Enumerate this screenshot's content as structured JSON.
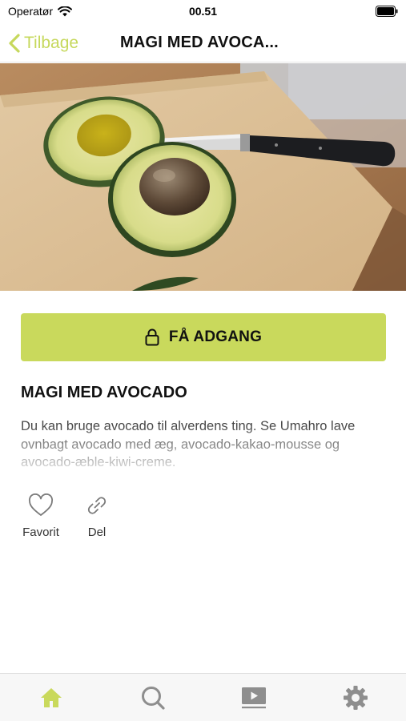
{
  "status_bar": {
    "carrier": "Operatør",
    "time": "00.51"
  },
  "nav": {
    "back_label": "Tilbage",
    "title": "MAGI MED AVOCA..."
  },
  "hero_image": {
    "subject": "halved avocado and knife on cutting board"
  },
  "access_button": {
    "label": "FÅ ADGANG",
    "icon": "lock-icon"
  },
  "article": {
    "title": "MAGI MED AVOCADO",
    "description": "Du kan bruge avocado til alverdens ting. Se Umahro lave ovnbagt avocado med æg, avocado-kakao-mousse og avocado-æble-kiwi-creme."
  },
  "actions": {
    "favorite_label": "Favorit",
    "share_label": "Del"
  },
  "tab_bar": {
    "tabs": [
      {
        "icon": "home-icon",
        "active": true
      },
      {
        "icon": "search-icon",
        "active": false
      },
      {
        "icon": "video-icon",
        "active": false
      },
      {
        "icon": "gear-icon",
        "active": false
      }
    ]
  },
  "colors": {
    "accent": "#c9d95c",
    "back_text": "#c6d85c",
    "inactive_icon": "#8e8e8e"
  }
}
